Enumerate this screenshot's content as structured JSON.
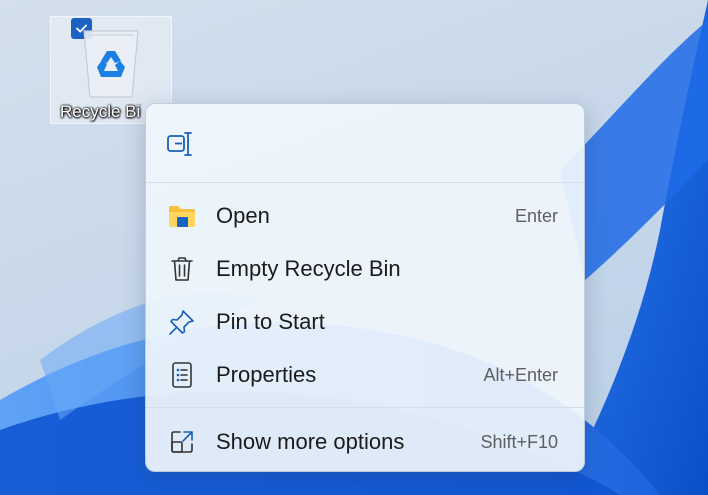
{
  "desktop": {
    "icon_label": "Recycle Bi",
    "icon_selected": true
  },
  "context_menu": {
    "quick_actions": [
      {
        "icon": "rename-icon"
      }
    ],
    "items": [
      {
        "label": "Open",
        "shortcut": "Enter",
        "icon": "folder-icon"
      },
      {
        "label": "Empty Recycle Bin",
        "shortcut": "",
        "icon": "trash-icon"
      },
      {
        "label": "Pin to Start",
        "shortcut": "",
        "icon": "pin-icon"
      },
      {
        "label": "Properties",
        "shortcut": "Alt+Enter",
        "icon": "properties-icon"
      }
    ],
    "more": {
      "label": "Show more options",
      "shortcut": "Shift+F10",
      "icon": "show-more-icon"
    }
  },
  "colors": {
    "accent": "#1a63c4",
    "menu_background": "#eff5fc",
    "text": "#1b1b1b",
    "shortcut_text": "#5f5f5f"
  }
}
